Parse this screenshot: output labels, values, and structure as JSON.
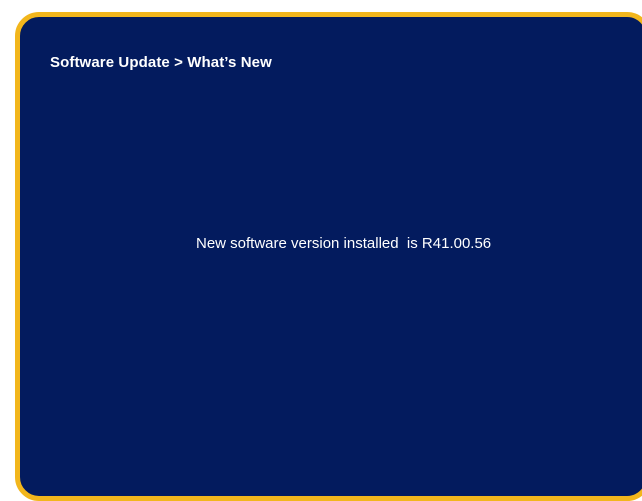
{
  "screen": {
    "breadcrumb": "Software Update > What’s New",
    "message": "New software version installed  is R41.00.56"
  },
  "colors": {
    "background": "#031b5e",
    "border": "#f2b61c",
    "text": "#ffffff"
  }
}
